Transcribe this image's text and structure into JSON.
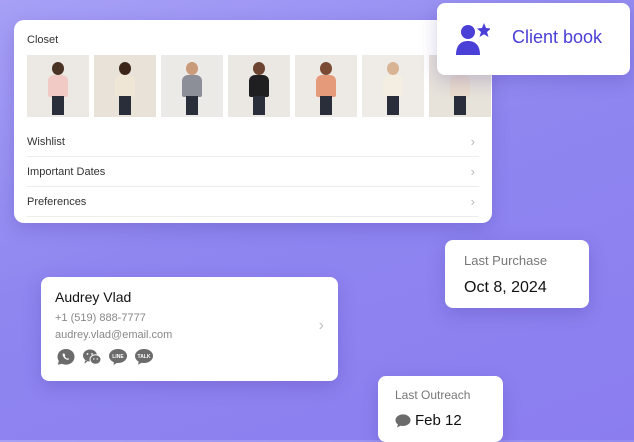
{
  "closet": {
    "title": "Closet",
    "thumbnails": [
      {
        "top": "#f1c9c5",
        "skin": "#4a3224",
        "bg": "#ece9e4"
      },
      {
        "top": "#efe6d6",
        "skin": "#3b2518",
        "bg": "#e8e2d8"
      },
      {
        "top": "#8c8f98",
        "skin": "#c99b7a",
        "bg": "#eceae6"
      },
      {
        "top": "#1f1f22",
        "skin": "#6b4330",
        "bg": "#ebe8e3"
      },
      {
        "top": "#e59a7a",
        "skin": "#7a4a32",
        "bg": "#edeae6"
      },
      {
        "top": "#f3ede2",
        "skin": "#d8b494",
        "bg": "#efece7"
      },
      {
        "top": "#e9dccd",
        "skin": "#a6705a",
        "bg": "#e7e2da"
      }
    ],
    "rows": [
      {
        "label": "Wishlist"
      },
      {
        "label": "Important Dates"
      },
      {
        "label": "Preferences"
      }
    ]
  },
  "client_book": {
    "label": "Client book",
    "accent": "#4a3fd6",
    "icon": "user-star-icon"
  },
  "last_purchase": {
    "label": "Last Purchase",
    "value": "Oct 8, 2024"
  },
  "contact": {
    "name": "Audrey Vlad",
    "phone": "+1 (519) 888-7777",
    "email": "audrey.vlad@email.com",
    "channels": [
      {
        "name": "whatsapp-icon",
        "text": ""
      },
      {
        "name": "wechat-icon",
        "text": ""
      },
      {
        "name": "line-icon",
        "text": "LINE"
      },
      {
        "name": "kakaotalk-icon",
        "text": "TALK"
      }
    ]
  },
  "last_outreach": {
    "label": "Last Outreach",
    "value": "Feb 12"
  }
}
